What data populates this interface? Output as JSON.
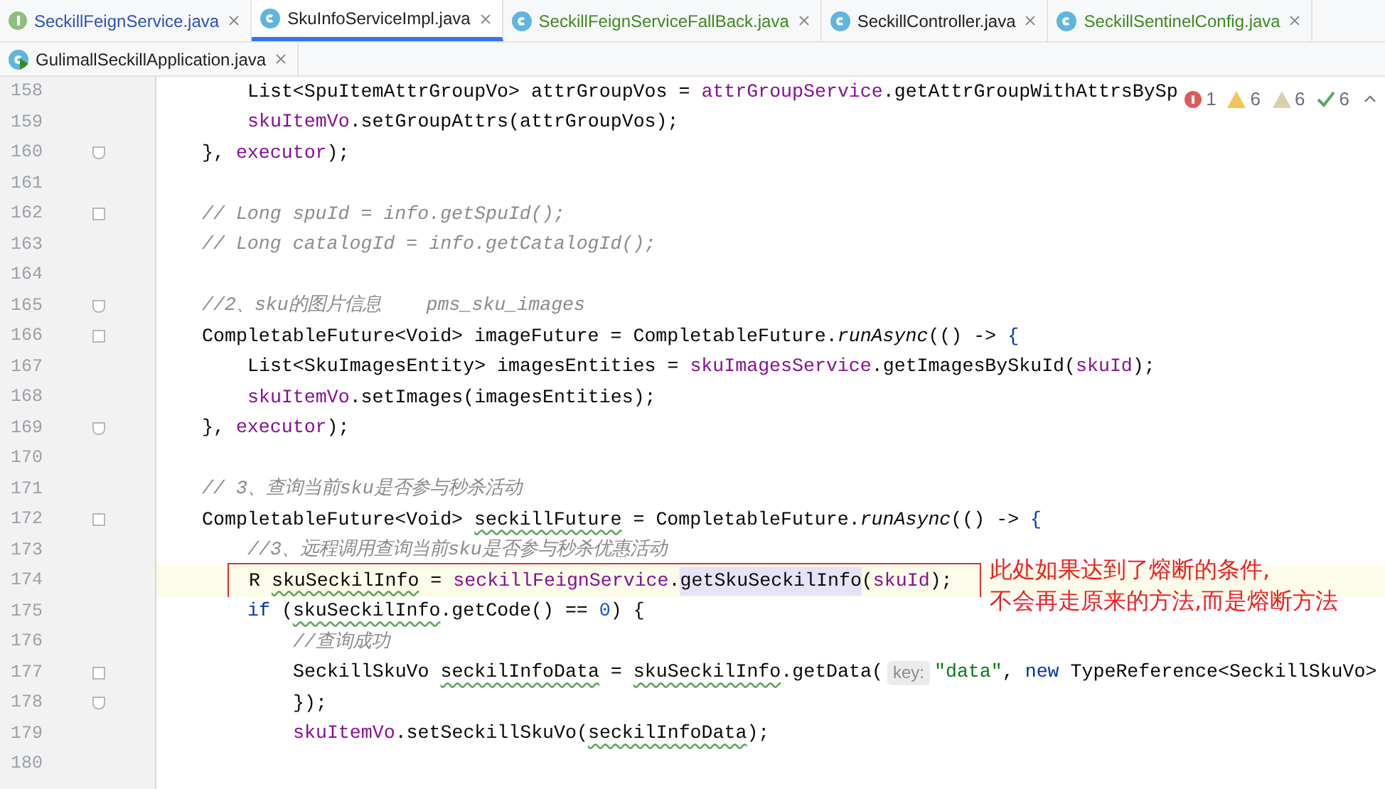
{
  "tabs": [
    {
      "label": "SeckillFeignService.java",
      "kind": "interface",
      "color": "#2a52be",
      "selected": false
    },
    {
      "label": "SkuInfoServiceImpl.java",
      "kind": "class",
      "color": "#1f1f1f",
      "selected": true
    },
    {
      "label": "SeckillFeignServiceFallBack.java",
      "kind": "class",
      "color": "#3d8a1f",
      "selected": false
    },
    {
      "label": "SeckillController.java",
      "kind": "class",
      "color": "#1f1f1f",
      "selected": false
    },
    {
      "label": "SeckillSentinelConfig.java",
      "kind": "class",
      "color": "#3d8a1f",
      "selected": false
    },
    {
      "label": "GulimallSeckillApplication.java",
      "kind": "app",
      "color": "#1f1f1f",
      "selected": false
    }
  ],
  "problems": [
    {
      "kind": "error",
      "count": "1"
    },
    {
      "kind": "warning",
      "count": "6"
    },
    {
      "kind": "weak",
      "count": "6"
    },
    {
      "kind": "typo",
      "count": "6"
    }
  ],
  "lines": [
    {
      "kind": "group",
      "children": [
        {
          "number": "158",
          "current": false,
          "tokens": [
            {
              "text": "List<SpuItemAttrGroupVo> attrGroupVos = ",
              "kind": "plain"
            },
            {
              "text": "attrGroupService",
              "kind": "field"
            },
            {
              "text": ".getAttrGroupWithAttrsBySp",
              "kind": "plain"
            }
          ]
        },
        {
          "number": "159",
          "current": false,
          "tokens": [
            {
              "text": "skuItemVo",
              "kind": "field"
            },
            {
              "text": ".setGroupAttrs(attrGroupVos);",
              "kind": "plain"
            }
          ]
        }
      ]
    },
    {
      "number": "160",
      "kind": "fold_end",
      "current": false,
      "tokens": [
        {
          "text": "}, ",
          "kind": "plain"
        },
        {
          "text": "executor",
          "kind": "field"
        },
        {
          "text": ");",
          "kind": "plain"
        }
      ]
    },
    {
      "number": "161",
      "current": false
    },
    {
      "number": "162",
      "kind": "fold_start",
      "current": false,
      "tokens": [
        {
          "text": "// Long spuId = info.getSpuId();",
          "kind": "comment"
        }
      ]
    },
    {
      "number": "163",
      "current": false,
      "tokens": [
        {
          "text": "// Long catalogId = info.getCatalogId();",
          "kind": "comment"
        }
      ]
    },
    {
      "number": "164",
      "current": false
    },
    {
      "number": "165",
      "kind": "fold_end",
      "current": false,
      "tokens": [
        {
          "text": "//2、sku的图片信息    pms_sku_images",
          "kind": "comment"
        }
      ]
    },
    {
      "number": "166",
      "kind": "fold_start",
      "current": false,
      "tokens": [
        {
          "text": "CompletableFuture<Void> imageFuture = CompletableFuture.",
          "kind": "plain"
        },
        {
          "text": "runAsync",
          "kind": "static"
        },
        {
          "text": "(() -> ",
          "kind": "plain"
        },
        {
          "text": "{",
          "kind": "brace"
        }
      ],
      "children": [
        {
          "number": "167",
          "current": false,
          "tokens": [
            {
              "text": "List<SkuImagesEntity> imagesEntities = ",
              "kind": "plain"
            },
            {
              "text": "skuImagesService",
              "kind": "field"
            },
            {
              "text": ".getImagesBySkuId(",
              "kind": "plain"
            },
            {
              "text": "skuId",
              "kind": "field"
            },
            {
              "text": ");",
              "kind": "plain"
            }
          ]
        },
        {
          "number": "168",
          "current": false,
          "tokens": [
            {
              "text": "skuItemVo",
              "kind": "field"
            },
            {
              "text": ".setImages(imagesEntities);",
              "kind": "plain"
            }
          ]
        }
      ]
    },
    {
      "number": "169",
      "kind": "fold_end",
      "current": false,
      "tokens": [
        {
          "text": "}, ",
          "kind": "plain"
        },
        {
          "text": "executor",
          "kind": "field"
        },
        {
          "text": ");",
          "kind": "plain"
        }
      ]
    },
    {
      "number": "170",
      "current": false
    },
    {
      "number": "171",
      "current": false,
      "tokens": [
        {
          "text": "// 3、查询当前sku是否参与秒杀活动",
          "kind": "comment"
        }
      ]
    },
    {
      "number": "172",
      "kind": "fold_start",
      "current": false,
      "tokens": [
        {
          "text": "CompletableFuture<Void> ",
          "kind": "plain"
        },
        {
          "text": "seckillFuture",
          "kind": "typo"
        },
        {
          "text": " = CompletableFuture.",
          "kind": "plain"
        },
        {
          "text": "runAsync",
          "kind": "static"
        },
        {
          "text": "(() -> ",
          "kind": "plain"
        },
        {
          "text": "{",
          "kind": "brace"
        }
      ],
      "children": [
        {
          "number": "173",
          "current": false,
          "tokens": [
            {
              "text": "//3、远程调用查询当前sku是否参与秒杀优惠活动",
              "kind": "comment"
            }
          ]
        },
        {
          "number": "174",
          "current": true,
          "tokens": [
            {
              "text": "R ",
              "kind": "plain"
            },
            {
              "text": "skuSeckilInfo",
              "kind": "typo"
            },
            {
              "text": " = ",
              "kind": "plain"
            },
            {
              "text": "seckillFeignService",
              "kind": "field"
            },
            {
              "text": ".",
              "kind": "plain"
            },
            {
              "text": "getSkuSeckilInfo",
              "kind": "selected"
            },
            {
              "text": "(",
              "kind": "plain"
            },
            {
              "text": "skuId",
              "kind": "field"
            },
            {
              "text": ");",
              "kind": "plain"
            }
          ],
          "callout": [
            "此处如果达到了熔断的条件,",
            "不会再走原来的方法,而是熔断方法"
          ]
        },
        {
          "number": "175",
          "current": false,
          "tokens": [
            {
              "text": "if",
              "kind": "keyword"
            },
            {
              "text": " (",
              "kind": "plain"
            },
            {
              "text": "skuSeckilInfo",
              "kind": "typo"
            },
            {
              "text": ".getCode() == ",
              "kind": "plain"
            },
            {
              "text": "0",
              "kind": "number"
            },
            {
              "text": ") {",
              "kind": "plain"
            }
          ],
          "children": [
            {
              "number": "176",
              "current": false,
              "tokens": [
                {
                  "text": "//查询成功",
                  "kind": "comment"
                }
              ]
            },
            {
              "number": "177",
              "kind": "fold_start",
              "current": false,
              "tokens": [
                {
                  "text": "SeckillSkuVo ",
                  "kind": "plain"
                },
                {
                  "text": "seckilInfoData",
                  "kind": "typo"
                },
                {
                  "text": " = ",
                  "kind": "plain"
                },
                {
                  "text": "skuSeckilInfo",
                  "kind": "typo"
                },
                {
                  "text": ".getData(",
                  "kind": "plain"
                },
                {
                  "text": "key:",
                  "kind": "hint"
                },
                {
                  "text": "\"data\"",
                  "kind": "string"
                },
                {
                  "text": ", ",
                  "kind": "plain"
                },
                {
                  "text": "new",
                  "kind": "keyword"
                },
                {
                  "text": " TypeReference<SeckillSkuVo>",
                  "kind": "plain"
                }
              ]
            },
            {
              "number": "178",
              "kind": "fold_end",
              "current": false,
              "tokens": [
                {
                  "text": "});",
                  "kind": "plain"
                }
              ]
            },
            {
              "number": "179",
              "current": false,
              "tokens": [
                {
                  "text": "skuItemVo",
                  "kind": "field"
                },
                {
                  "text": ".setSeckillSkuVo(",
                  "kind": "plain"
                },
                {
                  "text": "seckilInfoData",
                  "kind": "typo"
                },
                {
                  "text": ");",
                  "kind": "plain"
                }
              ]
            }
          ]
        }
      ]
    },
    {
      "number": "180",
      "current": false
    }
  ]
}
